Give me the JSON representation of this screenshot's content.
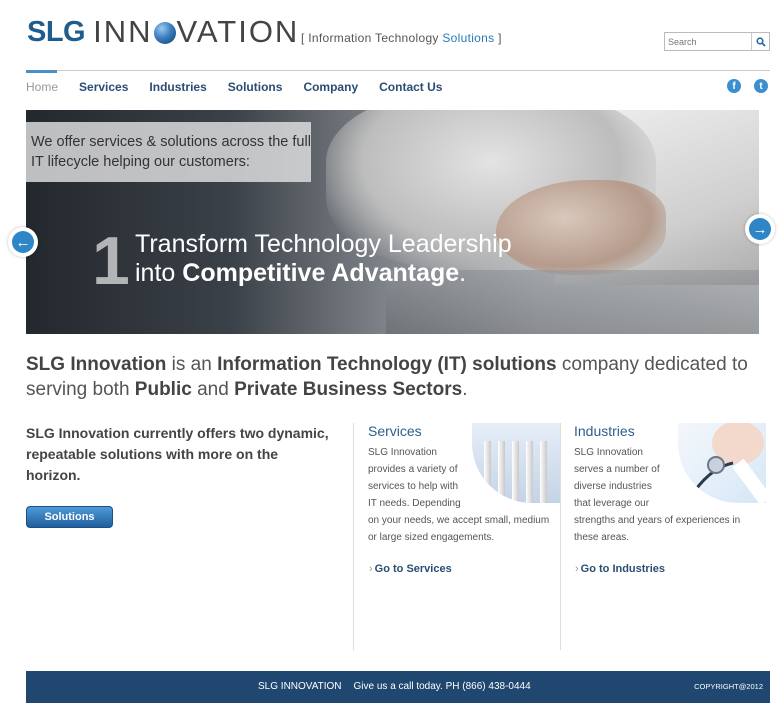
{
  "header": {
    "logo_slg": "SLG",
    "logo_inno_a": "INN",
    "logo_inno_b": "VATION",
    "tagline_prefix": "[ Information Technology ",
    "tagline_accent": "Solutions",
    "tagline_suffix": " ]",
    "search_placeholder": "Search",
    "search_icon": "magnifier-icon"
  },
  "nav": {
    "items": [
      {
        "label": "Home"
      },
      {
        "label": "Services"
      },
      {
        "label": "Industries"
      },
      {
        "label": "Solutions"
      },
      {
        "label": "Company"
      },
      {
        "label": "Contact Us"
      }
    ],
    "social": {
      "facebook": "f",
      "twitter": "t"
    }
  },
  "hero": {
    "box_text_1": "We offer services & solutions across the full",
    "box_text_2": "IT lifecycle helping our customers:",
    "number": "1",
    "line1": "Transform Technology Leadership",
    "line2_prefix": "into ",
    "line2_bold": "Competitive Advantage",
    "line2_suffix": ".",
    "prev_icon": "←",
    "next_icon": "→"
  },
  "intro": {
    "p1": "SLG Innovation",
    "p2": " is an ",
    "p3": "Information Technology (IT) solutions",
    "p4": " company dedicated to serving both ",
    "p5": "Public",
    "p6": " and ",
    "p7": "Private Business Sectors",
    "p8": "."
  },
  "solutions_col": {
    "text": "SLG Innovation currently offers two dynamic, repeatable solutions with more on the horizon.",
    "button": "Solutions"
  },
  "services_col": {
    "title": "Services",
    "lines": [
      "SLG Innovation",
      "provides a variety of",
      "services to help with",
      "IT needs.  Depending",
      "on your needs, we accept small, medium",
      "or large sized engagements."
    ],
    "link": "Go to Services"
  },
  "industries_col": {
    "title": "Industries",
    "lines": [
      "SLG Innovation",
      "serves a number of",
      "diverse industries",
      "that leverage our",
      "strengths and years of experiences in",
      "these areas."
    ],
    "link": "Go to Industries"
  },
  "footer": {
    "company": "SLG INNOVATION",
    "call": "Give us a call today. PH (866) 438-0444",
    "copyright": "COPYRIGHT@2012"
  },
  "colors": {
    "brand_blue": "#1f5d8f",
    "nav_text": "#2b4d73",
    "footer_bg": "#1f4770"
  }
}
